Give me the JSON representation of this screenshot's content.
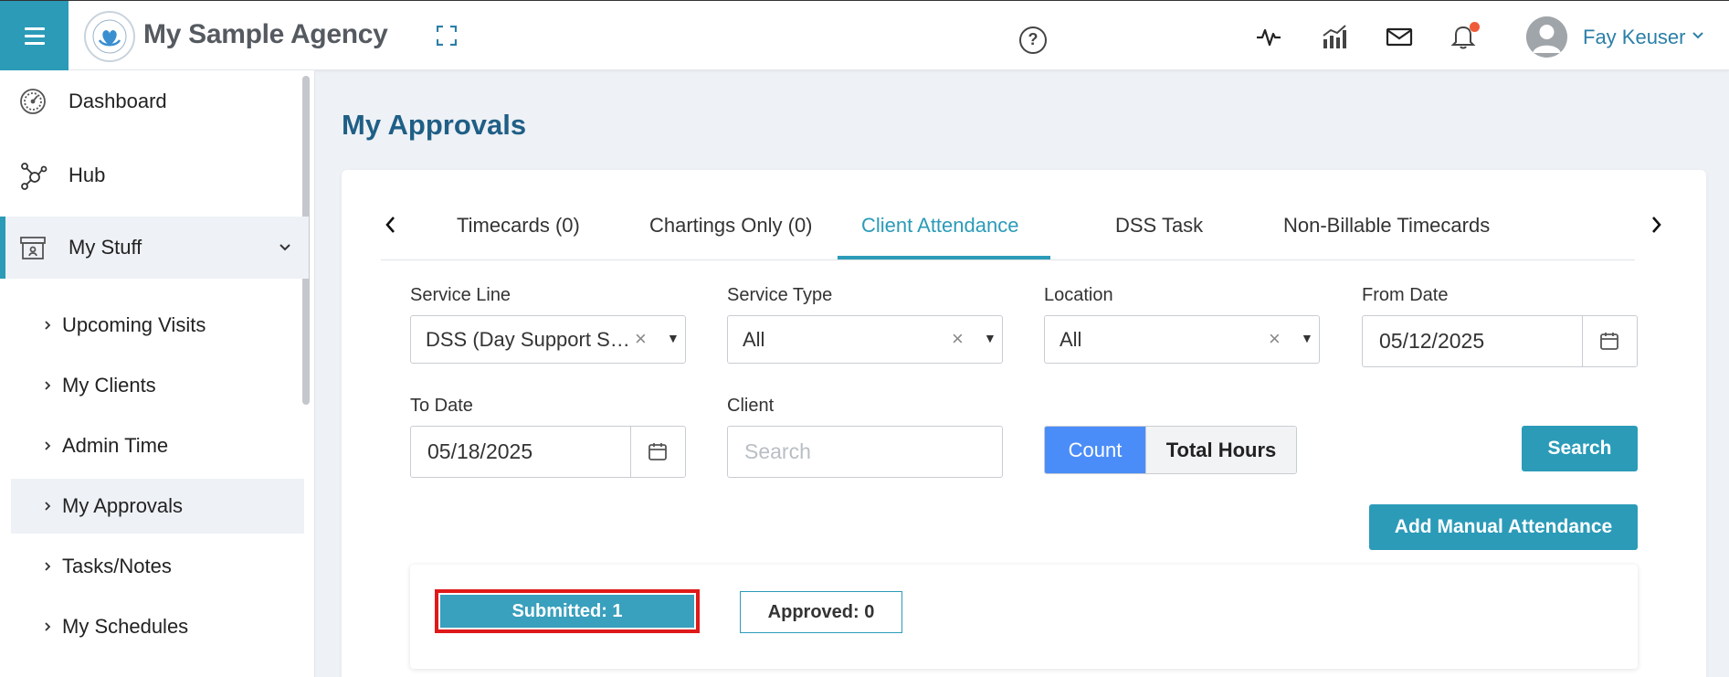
{
  "header": {
    "agency_name": "My Sample Agency",
    "user_name": "Fay Keuser",
    "icons": [
      "menu-icon",
      "agency-logo",
      "fullscreen-icon",
      "help-icon",
      "activity-icon",
      "analytics-icon",
      "mail-icon",
      "bell-icon",
      "user-avatar",
      "chevron-down-icon"
    ],
    "notification_dot_color": "#f05a3a"
  },
  "sidebar": {
    "items": [
      {
        "label": "Dashboard",
        "icon": "speedometer-icon"
      },
      {
        "label": "Hub",
        "icon": "hub-icon"
      },
      {
        "label": "My Stuff",
        "icon": "archive-box-icon",
        "expanded": true
      }
    ],
    "subitems": [
      {
        "label": "Upcoming Visits"
      },
      {
        "label": "My Clients"
      },
      {
        "label": "Admin Time"
      },
      {
        "label": "My Approvals",
        "selected": true
      },
      {
        "label": "Tasks/Notes"
      },
      {
        "label": "My Schedules"
      }
    ]
  },
  "main": {
    "title": "My Approvals",
    "tabs": [
      {
        "label": "Timecards (0)"
      },
      {
        "label": "Chartings Only (0)"
      },
      {
        "label": "Client Attendance",
        "active": true
      },
      {
        "label": "DSS Task"
      },
      {
        "label": "Non-Billable Timecards"
      }
    ],
    "filters": {
      "service_line": {
        "label": "Service Line",
        "value": "DSS (Day Support Ser..."
      },
      "service_type": {
        "label": "Service Type",
        "value": "All"
      },
      "location": {
        "label": "Location",
        "value": "All"
      },
      "from_date": {
        "label": "From Date",
        "value": "05/12/2025"
      },
      "to_date": {
        "label": "To Date",
        "value": "05/18/2025"
      },
      "client": {
        "label": "Client",
        "placeholder": "Search",
        "value": ""
      }
    },
    "toggle": {
      "count_label": "Count",
      "total_hours_label": "Total Hours",
      "selected": "Count"
    },
    "search_button": "Search",
    "add_manual_button": "Add Manual Attendance",
    "status": {
      "submitted": "Submitted: 1",
      "approved": "Approved: 0"
    }
  },
  "colors": {
    "accent": "#2b9bb8",
    "title": "#1f5f86",
    "toggle_on": "#4b8df8",
    "highlight_border": "#e01919"
  }
}
